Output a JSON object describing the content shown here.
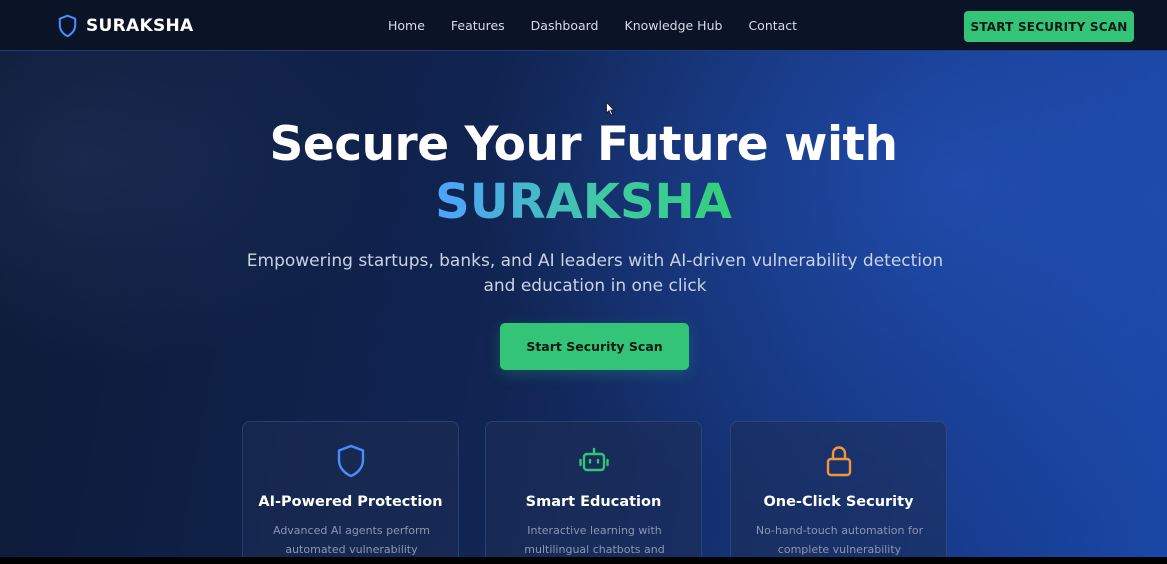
{
  "navbar": {
    "brand": "SURAKSHA",
    "links": [
      "Home",
      "Features",
      "Dashboard",
      "Knowledge Hub",
      "Contact"
    ],
    "cta_label": "START SECURITY SCAN"
  },
  "hero": {
    "title_line1": "Secure Your Future with",
    "title_line2": "SURAKSHA",
    "subtitle": "Empowering startups, banks, and AI leaders with AI-driven vulnerability detection and education in one click",
    "cta_label": "Start Security Scan"
  },
  "features": [
    {
      "icon": "shield-icon",
      "title": "AI-Powered Protection",
      "description": "Advanced AI agents perform automated vulnerability"
    },
    {
      "icon": "robot-icon",
      "title": "Smart Education",
      "description": "Interactive learning with multilingual chatbots and"
    },
    {
      "icon": "lock-icon",
      "title": "One-Click Security",
      "description": "No-hand-touch automation for complete vulnerability"
    }
  ],
  "colors": {
    "accent_green": "#34c477",
    "shield_blue": "#4a8dff",
    "robot_green": "#34c477",
    "lock_orange": "#f5953a"
  }
}
